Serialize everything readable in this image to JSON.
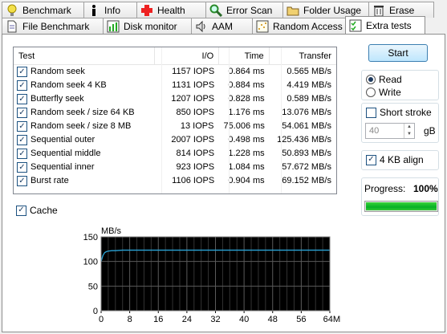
{
  "tabs_top": [
    {
      "label": "Benchmark",
      "icon": "benchmark-bulb-icon"
    },
    {
      "label": "Info",
      "icon": "info-icon"
    },
    {
      "label": "Health",
      "icon": "health-cross-icon"
    },
    {
      "label": "Error Scan",
      "icon": "magnifier-icon"
    },
    {
      "label": "Folder Usage",
      "icon": "folder-icon"
    },
    {
      "label": "Erase",
      "icon": "trash-icon"
    }
  ],
  "tabs_bottom": [
    {
      "label": "File Benchmark",
      "icon": "file-icon"
    },
    {
      "label": "Disk monitor",
      "icon": "chart-icon"
    },
    {
      "label": "AAM",
      "icon": "speaker-icon"
    },
    {
      "label": "Random Access",
      "icon": "scatter-icon"
    },
    {
      "label": "Extra tests",
      "icon": "checklist-icon"
    }
  ],
  "table": {
    "headers": [
      "Test",
      "I/O",
      "Time",
      "Transfer"
    ],
    "rows": [
      {
        "checked": true,
        "test": "Random seek",
        "io": "1157 IOPS",
        "time": "0.864 ms",
        "transfer": "0.565 MB/s"
      },
      {
        "checked": true,
        "test": "Random seek 4 KB",
        "io": "1131 IOPS",
        "time": "0.884 ms",
        "transfer": "4.419 MB/s"
      },
      {
        "checked": true,
        "test": "Butterfly seek",
        "io": "1207 IOPS",
        "time": "0.828 ms",
        "transfer": "0.589 MB/s"
      },
      {
        "checked": true,
        "test": "Random seek / size 64 KB",
        "io": "850 IOPS",
        "time": "1.176 ms",
        "transfer": "13.076 MB/s"
      },
      {
        "checked": true,
        "test": "Random seek / size 8 MB",
        "io": "13 IOPS",
        "time": "75.006 ms",
        "transfer": "54.061 MB/s"
      },
      {
        "checked": true,
        "test": "Sequential outer",
        "io": "2007 IOPS",
        "time": "0.498 ms",
        "transfer": "125.436 MB/s"
      },
      {
        "checked": true,
        "test": "Sequential middle",
        "io": "814 IOPS",
        "time": "1.228 ms",
        "transfer": "50.893 MB/s"
      },
      {
        "checked": true,
        "test": "Sequential inner",
        "io": "923 IOPS",
        "time": "1.084 ms",
        "transfer": "57.672 MB/s"
      },
      {
        "checked": true,
        "test": "Burst rate",
        "io": "1106 IOPS",
        "time": "0.904 ms",
        "transfer": "69.152 MB/s"
      }
    ]
  },
  "start_label": "Start",
  "mode": {
    "read_label": "Read",
    "write_label": "Write",
    "selected": "Read"
  },
  "short_stroke": {
    "label": "Short stroke",
    "checked": false,
    "value": "40",
    "unit": "gB"
  },
  "align": {
    "label": "4 KB align",
    "checked": true
  },
  "progress": {
    "label": "Progress:",
    "value_text": "100%",
    "fraction": 1.0
  },
  "cache": {
    "label": "Cache",
    "checked": true
  },
  "chart_data": {
    "type": "line",
    "ylabel": "MB/s",
    "xlabel_unit": "MB",
    "ylim": [
      0,
      150
    ],
    "y_ticks": [
      0,
      50,
      100,
      150
    ],
    "xlim": [
      0,
      64
    ],
    "x_ticks": [
      "0",
      "8",
      "16",
      "24",
      "32",
      "40",
      "48",
      "56",
      "64MB"
    ],
    "grid": true,
    "background": "#000000",
    "line_color": "#29a3d6",
    "series": [
      {
        "x": [
          0,
          0.5,
          1,
          1.5,
          2,
          3,
          4,
          6,
          8,
          12,
          16,
          24,
          32,
          40,
          48,
          56,
          64
        ],
        "y": [
          100,
          112,
          118,
          120,
          121,
          122,
          122,
          123,
          123,
          123,
          123,
          123,
          123,
          123,
          123,
          123,
          123
        ]
      }
    ]
  }
}
